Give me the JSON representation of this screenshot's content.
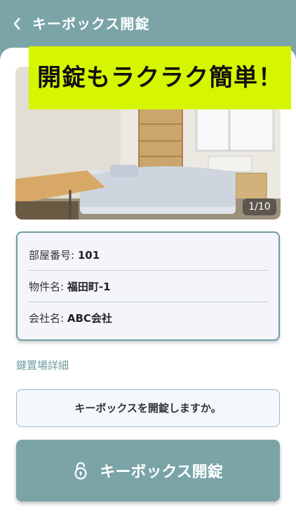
{
  "header": {
    "title": "キーボックス開錠",
    "back_icon": "chevron-left-icon"
  },
  "banner": {
    "text": "開錠もラクラク簡単！"
  },
  "gallery": {
    "counter": "1/10"
  },
  "info": {
    "room_label": "部屋番号:",
    "room_value": "101",
    "property_label": "物件名:",
    "property_value": "福田町-1",
    "company_label": "会社名:",
    "company_value": "ABC会社"
  },
  "details_link": "鍵置場詳細",
  "confirm_text": "キーボックスを開錠しますか。",
  "unlock_button": {
    "label": "キーボックス開錠",
    "icon": "lock-icon"
  },
  "colors": {
    "primary": "#7ba4a7",
    "banner": "#d6f500"
  }
}
